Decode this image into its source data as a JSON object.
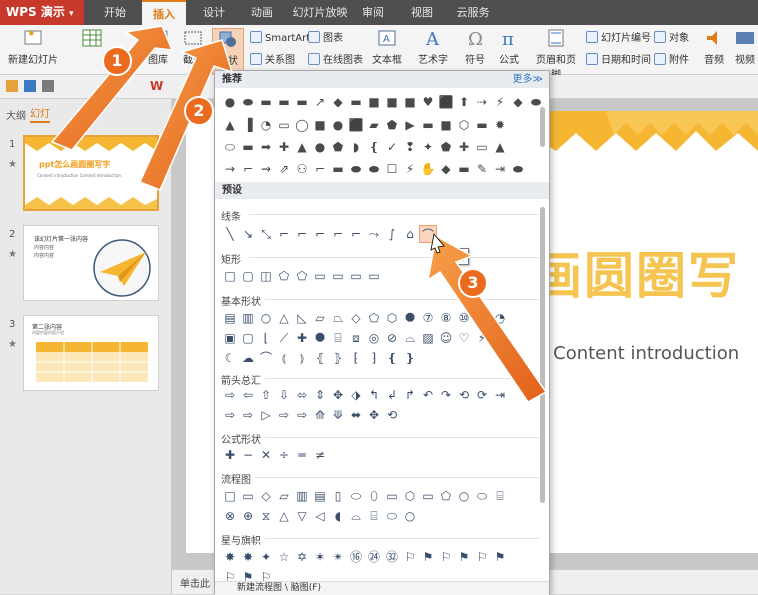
{
  "app": {
    "title": "WPS 演示"
  },
  "tabs": [
    {
      "label": "开始"
    },
    {
      "label": "插入"
    },
    {
      "label": "设计"
    },
    {
      "label": "动画"
    },
    {
      "label": "幻灯片放映"
    },
    {
      "label": "审阅"
    },
    {
      "label": "视图"
    },
    {
      "label": "云服务"
    }
  ],
  "ribbon": {
    "new_slide": "新建幻灯片",
    "picture_lib": "图库",
    "screenshot": "截屏",
    "shapes": "形状",
    "smartart": "SmartArt",
    "chart": "图表",
    "relation": "关系图",
    "online_chart": "在线图表",
    "textbox": "文本框",
    "wordart": "艺术字",
    "symbol": "符号",
    "formula": "公式",
    "header_footer": "页眉和页脚",
    "slide_number": "幻灯片编号",
    "date_time": "日期和时间",
    "object": "对象",
    "attachment": "附件",
    "audio": "音频",
    "video": "视频"
  },
  "left_pane": {
    "outline_tab": "大纲",
    "slides_tab": "幻灯",
    "slides": [
      {
        "num": "1",
        "title": "ppt怎么画圆圈写字",
        "sub": "Content introduction Content introduction"
      },
      {
        "num": "2",
        "title": "该幻灯片第一张内容",
        "bullets": [
          "内容内容",
          "内容内容"
        ]
      },
      {
        "num": "3",
        "title": "第二张内容",
        "sub": "内容内容内容介绍"
      }
    ]
  },
  "slide": {
    "title_fragment": "画圆圈写",
    "sub_fragment": "n Content introduction"
  },
  "status": {
    "hint": "单击此"
  },
  "dropdown": {
    "recommended": "推荐",
    "more": "更多≫",
    "preset": "预设",
    "categories": {
      "lines": "线条",
      "rect": "矩形",
      "basic": "基本形状",
      "arrows": "箭头总汇",
      "formula": "公式形状",
      "flow": "流程图",
      "stars": "星与旗帜"
    },
    "tooltip": "曲线",
    "footer": "新建流程图 \\ 脑图(F)"
  },
  "callouts": [
    "1",
    "2",
    "3"
  ],
  "colors": {
    "accent": "#e07b19",
    "callout": "#ec6a1d",
    "app_red": "#c7392b",
    "selection": "#e8a039"
  }
}
